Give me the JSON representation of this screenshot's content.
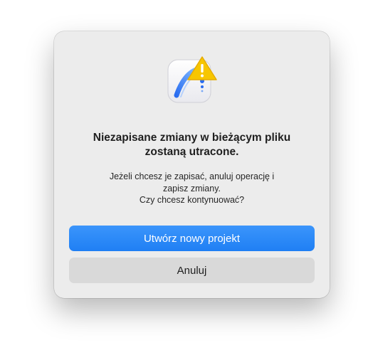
{
  "dialog": {
    "title_line1": "Niezapisane zmiany w bieżącym pliku",
    "title_line2": "zostaną utracone.",
    "message_line1": "Jeżeli chcesz je zapisać, anuluj operację i",
    "message_line2": "zapisz zmiany.",
    "message_line3": "Czy chcesz kontynuować?",
    "primary_button": "Utwórz nowy projekt",
    "secondary_button": "Anuluj",
    "icon": "app-icon-with-warning-badge"
  },
  "colors": {
    "accent": "#1f7ff4",
    "warning": "#f5c400",
    "dialog_bg": "#ececec"
  }
}
